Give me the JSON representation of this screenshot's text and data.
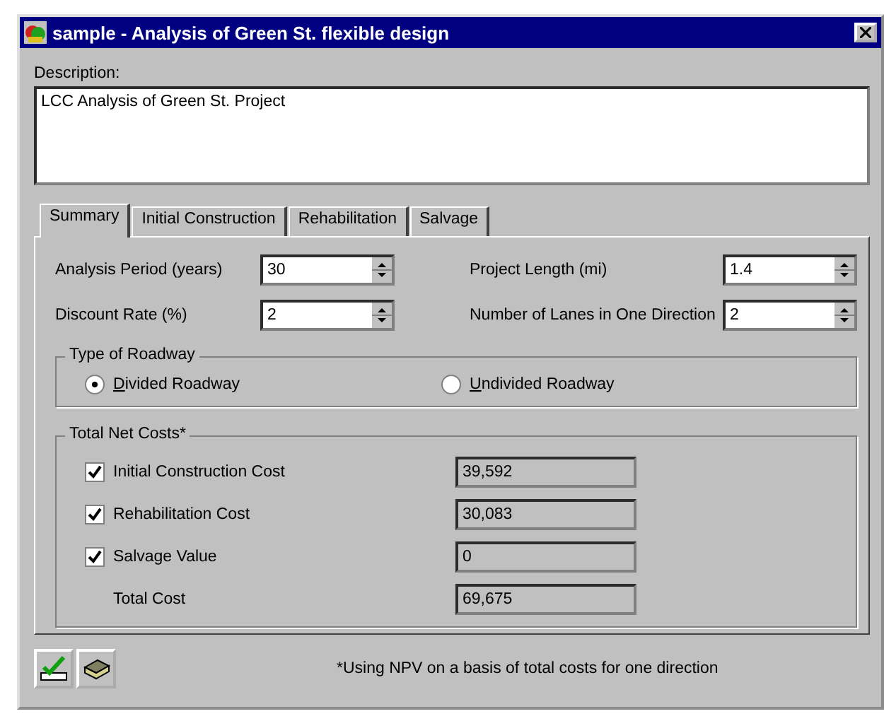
{
  "window": {
    "title": "sample - Analysis of Green St. flexible design"
  },
  "description": {
    "label": "Description:",
    "value": "LCC Analysis of Green St. Project"
  },
  "tabs": [
    {
      "label": "Summary",
      "selected": true
    },
    {
      "label": "Initial Construction",
      "selected": false
    },
    {
      "label": "Rehabilitation",
      "selected": false
    },
    {
      "label": "Salvage",
      "selected": false
    }
  ],
  "fields": [
    {
      "label": "Analysis Period (years)",
      "value": "30"
    },
    {
      "label": "Project Length (mi)",
      "value": "1.4"
    },
    {
      "label": "Discount Rate (%)",
      "value": "2"
    },
    {
      "label": "Number of Lanes in One Direction",
      "value": "2"
    }
  ],
  "roadway": {
    "title": "Type of Roadway",
    "options": [
      {
        "label": "Divided Roadway",
        "selected": true
      },
      {
        "label": "Undivided Roadway",
        "selected": false
      }
    ]
  },
  "costs": {
    "title": "Total Net Costs*",
    "rows": [
      {
        "kind": "checkbox",
        "label": "Initial Construction Cost",
        "checked": true,
        "value": "39,592"
      },
      {
        "kind": "checkbox",
        "label": "Rehabilitation Cost",
        "checked": true,
        "value": "30,083"
      },
      {
        "kind": "checkbox",
        "label": "Salvage Value",
        "checked": true,
        "value": "0"
      },
      {
        "kind": "total",
        "label": "Total Cost",
        "value": "69,675"
      }
    ]
  },
  "footnote": "*Using NPV on a basis of total costs for one direction"
}
